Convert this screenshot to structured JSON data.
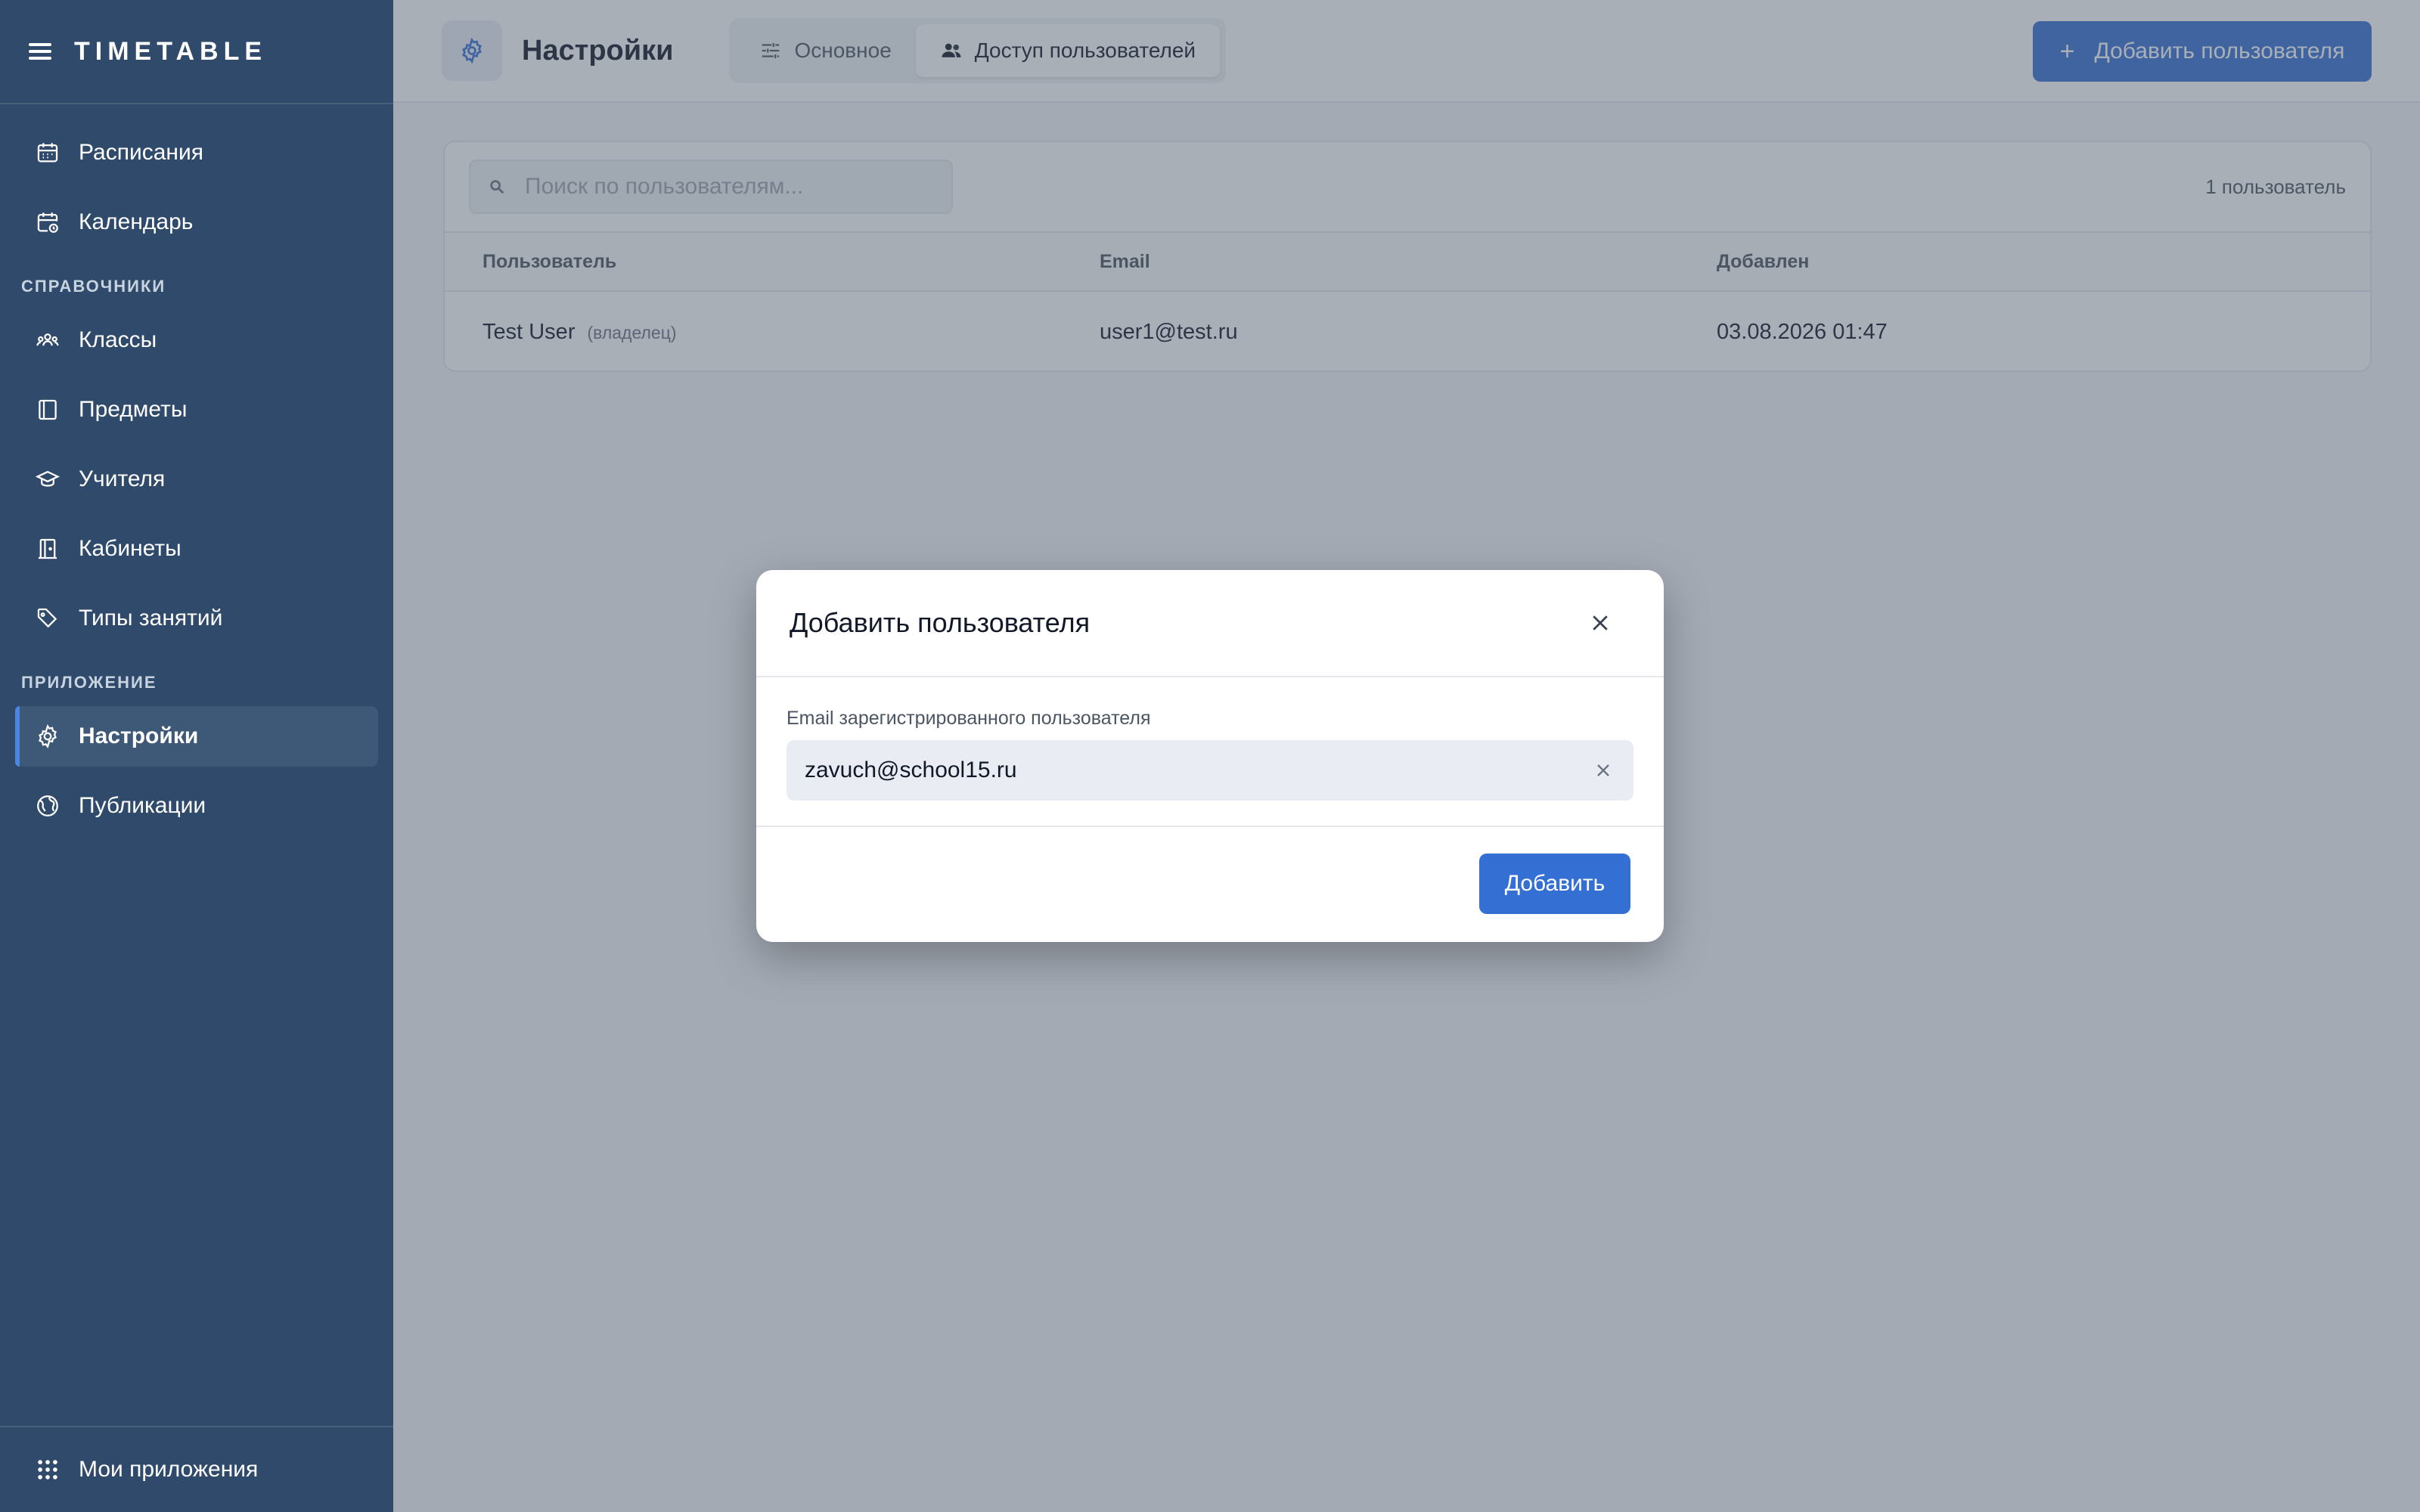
{
  "app": {
    "logo": "TIMETABLE"
  },
  "sidebar": {
    "items_top": [
      {
        "label": "Расписания",
        "icon": "calendar-icon"
      },
      {
        "label": "Календарь",
        "icon": "calendar-clock-icon"
      }
    ],
    "section_refs": "СПРАВОЧНИКИ",
    "items_refs": [
      {
        "label": "Классы",
        "icon": "group-icon"
      },
      {
        "label": "Предметы",
        "icon": "book-icon"
      },
      {
        "label": "Учителя",
        "icon": "graduation-cap-icon"
      },
      {
        "label": "Кабинеты",
        "icon": "door-icon"
      },
      {
        "label": "Типы занятий",
        "icon": "tag-icon"
      }
    ],
    "section_app": "ПРИЛОЖЕНИЕ",
    "items_app": [
      {
        "label": "Настройки",
        "icon": "gear-icon",
        "active": true
      },
      {
        "label": "Публикации",
        "icon": "globe-icon"
      }
    ],
    "footer": {
      "label": "Мои приложения",
      "icon": "apps-grid-icon"
    }
  },
  "header": {
    "title": "Настройки",
    "tabs": [
      {
        "label": "Основное",
        "icon": "sliders-icon"
      },
      {
        "label": "Доступ пользователей",
        "icon": "users-icon",
        "active": true
      }
    ],
    "add_button": "Добавить пользователя"
  },
  "users": {
    "search_placeholder": "Поиск по пользователям...",
    "count": "1 пользователь",
    "columns": [
      "Пользователь",
      "Email",
      "Добавлен"
    ],
    "rows": [
      {
        "name": "Test User",
        "role": "(владелец)",
        "email": "user1@test.ru",
        "added": "03.08.2026 01:47"
      }
    ]
  },
  "modal": {
    "title": "Добавить пользователя",
    "field_label": "Email зарегистрированного пользователя",
    "field_value": "zavuch@school15.ru",
    "submit": "Добавить"
  },
  "colors": {
    "sidebar": "#2f4a6a",
    "accent": "#3470d4"
  }
}
